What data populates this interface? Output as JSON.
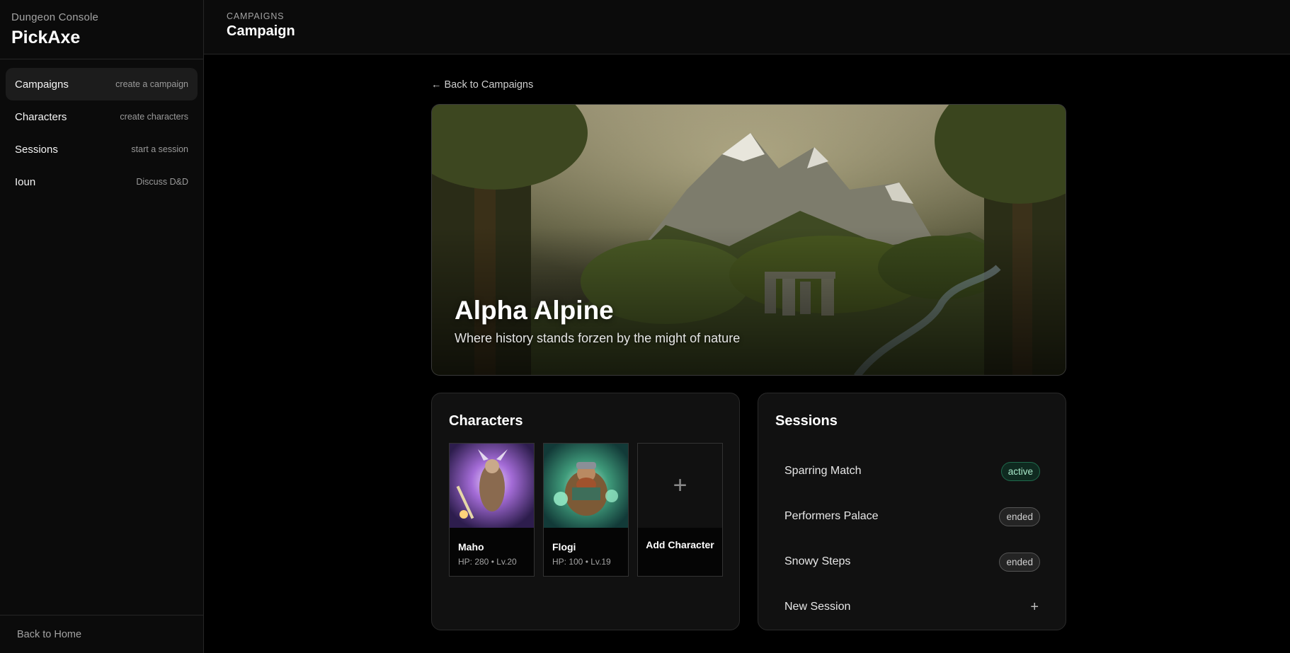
{
  "sidebar": {
    "brand_sub": "Dungeon Console",
    "brand_title": "PickAxe",
    "items": [
      {
        "label": "Campaigns",
        "hint": "create a campaign"
      },
      {
        "label": "Characters",
        "hint": "create characters"
      },
      {
        "label": "Sessions",
        "hint": "start a session"
      },
      {
        "label": "Ioun",
        "hint": "Discuss D&D"
      }
    ],
    "footer": "Back to Home"
  },
  "header": {
    "crumb": "CAMPAIGNS",
    "title": "Campaign"
  },
  "main": {
    "back_link": "Back to Campaigns",
    "hero": {
      "title": "Alpha Alpine",
      "subtitle": "Where history stands forzen by the might of nature"
    },
    "characters": {
      "title": "Characters",
      "items": [
        {
          "name": "Maho",
          "stats": "HP: 280 • Lv.20"
        },
        {
          "name": "Flogi",
          "stats": "HP: 100 • Lv.19"
        }
      ],
      "add_label": "Add Character"
    },
    "sessions": {
      "title": "Sessions",
      "items": [
        {
          "name": "Sparring Match",
          "status": "active"
        },
        {
          "name": "Performers Palace",
          "status": "ended"
        },
        {
          "name": "Snowy Steps",
          "status": "ended"
        }
      ],
      "new_label": "New Session"
    }
  },
  "icons": {
    "back": "arrow-left-icon",
    "add": "plus-icon"
  },
  "colors": {
    "background": "#000000",
    "panel": "#111111",
    "active_badge": "#0f2a20",
    "active_badge_text": "#a7e7c8"
  }
}
